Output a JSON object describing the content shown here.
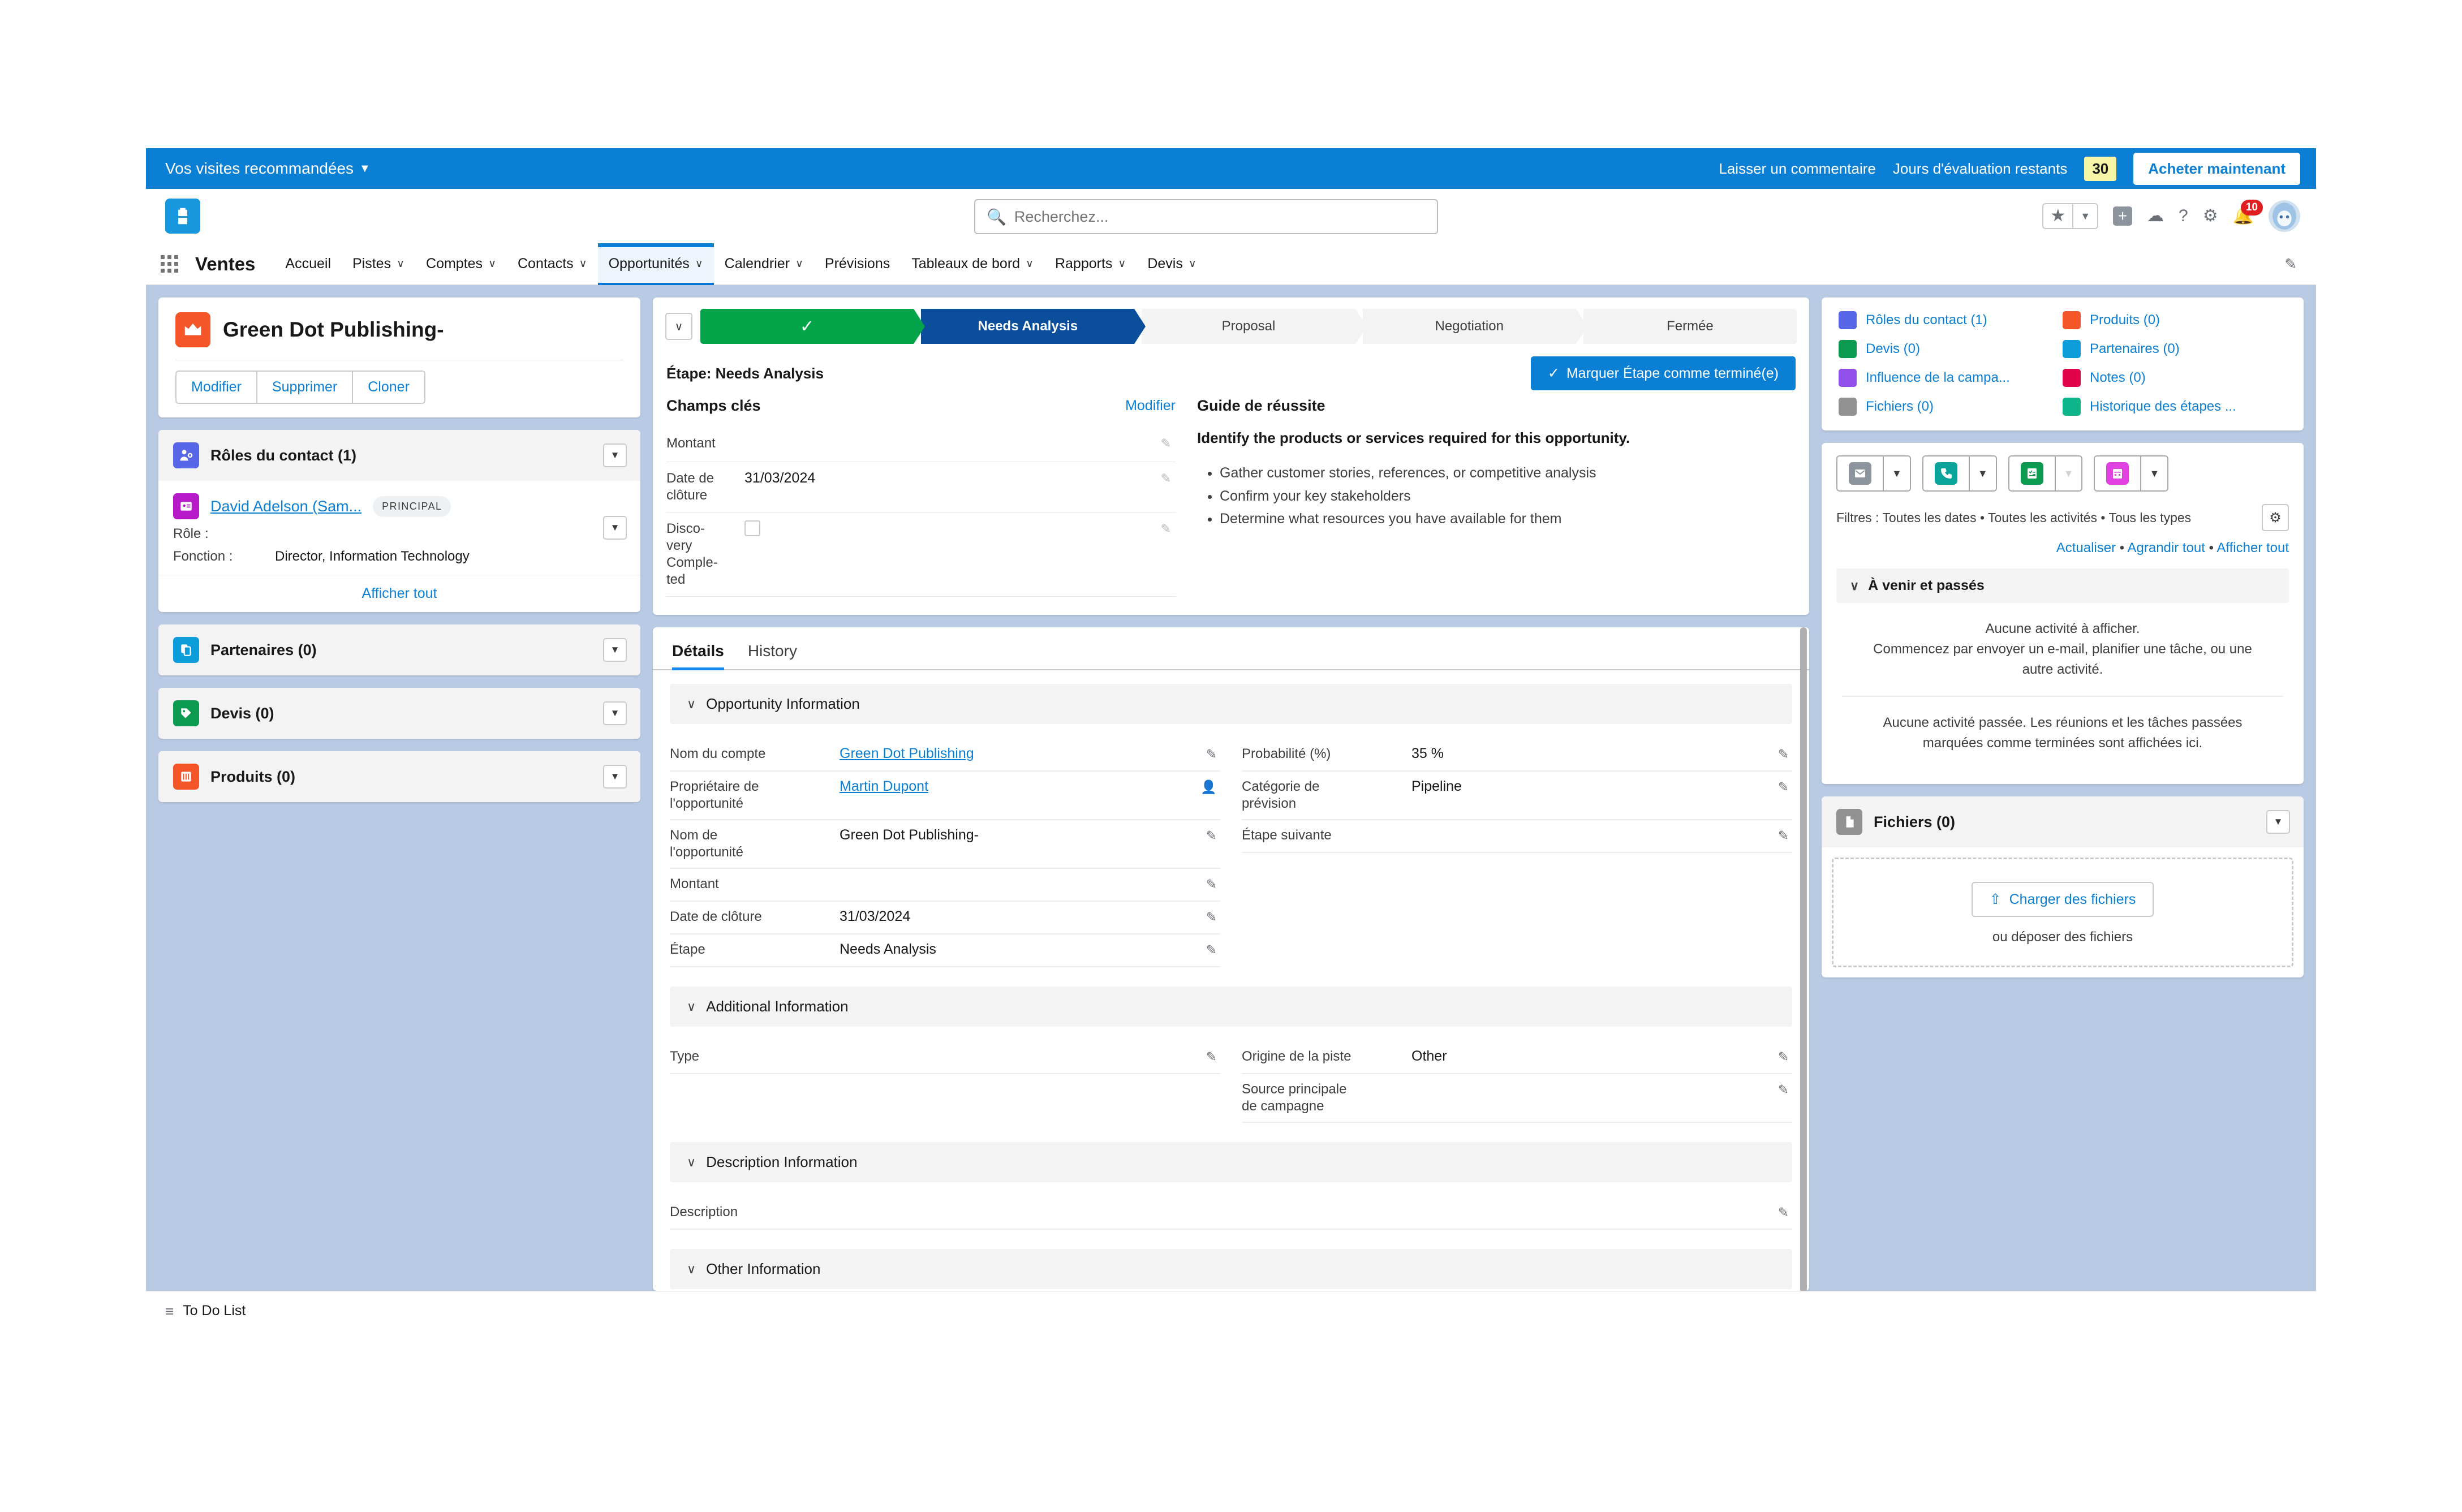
{
  "trial_bar": {
    "recommended_label": "Vos visites recommandées",
    "leave_comment": "Laisser un commentaire",
    "days_label": "Jours d'évaluation restants",
    "days_value": "30",
    "buy_now": "Acheter maintenant"
  },
  "header": {
    "search_placeholder": "Recherchez...",
    "notification_count": "10",
    "icons": [
      "favorites-star-icon",
      "favorites-chevron-icon",
      "add-icon",
      "cloud-icon",
      "help-icon",
      "setup-gear-icon",
      "notifications-bell-icon",
      "user-avatar"
    ]
  },
  "nav": {
    "app_name": "Ventes",
    "items": [
      {
        "label": "Accueil",
        "has_caret": false,
        "active": false
      },
      {
        "label": "Pistes",
        "has_caret": true,
        "active": false
      },
      {
        "label": "Comptes",
        "has_caret": true,
        "active": false
      },
      {
        "label": "Contacts",
        "has_caret": true,
        "active": false
      },
      {
        "label": "Opportunités",
        "has_caret": true,
        "active": true
      },
      {
        "label": "Calendrier",
        "has_caret": true,
        "active": false
      },
      {
        "label": "Prévisions",
        "has_caret": false,
        "active": false
      },
      {
        "label": "Tableaux de bord",
        "has_caret": true,
        "active": false
      },
      {
        "label": "Rapports",
        "has_caret": true,
        "active": false
      },
      {
        "label": "Devis",
        "has_caret": true,
        "active": false
      }
    ]
  },
  "highlight": {
    "title": "Green Dot Publishing-",
    "actions": [
      "Modifier",
      "Supprimer",
      "Cloner"
    ]
  },
  "sidebar": {
    "contact_roles": {
      "title": "Rôles du contact (1)",
      "color": "#5867e8",
      "contact_name": "David Adelson (Sam...",
      "badge": "PRINCIPAL",
      "role_label": "Rôle :",
      "role_value": "",
      "function_label": "Fonction :",
      "function_value": "Director, Information Technology",
      "view_all": "Afficher tout"
    },
    "cards": [
      {
        "title": "Partenaires (0)",
        "color": "#0d9dda",
        "icon": "partners-icon"
      },
      {
        "title": "Devis (0)",
        "color": "#0b9a4f",
        "icon": "quotes-icon"
      },
      {
        "title": "Produits (0)",
        "color": "#f4562a",
        "icon": "products-icon"
      }
    ]
  },
  "path": {
    "stages": [
      {
        "label": "",
        "state": "done",
        "check": "✓"
      },
      {
        "label": "Needs Analysis",
        "state": "current"
      },
      {
        "label": "Proposal",
        "state": "todo"
      },
      {
        "label": "Negotiation",
        "state": "todo"
      },
      {
        "label": "Fermée",
        "state": "todo"
      }
    ],
    "stage_label": "Étape: Needs Analysis",
    "mark_complete": "Marquer Étape comme terminé(e)",
    "key_fields_title": "Champs clés",
    "edit_link": "Modifier",
    "key_fields": [
      {
        "label": "Montant",
        "value": "",
        "type": "text"
      },
      {
        "label": "Date de clôture",
        "value": "31/03/2024",
        "type": "text"
      },
      {
        "label": "Disco-very Comple-ted",
        "value": "",
        "type": "checkbox"
      }
    ],
    "guide_title": "Guide de réussite",
    "guide_lead": "Identify the products or services required for this opportunity.",
    "guide_items": [
      "Gather customer stories, references, or competitive analysis",
      "Confirm your key stakeholders",
      "Determine what resources you have available for them"
    ]
  },
  "details": {
    "tabs": [
      {
        "label": "Détails",
        "active": true
      },
      {
        "label": "History",
        "active": false
      }
    ],
    "sections": [
      {
        "title": "Opportunity Information",
        "left_fields": [
          {
            "label": "Nom du compte",
            "value": "Green Dot Publishing",
            "link": true
          },
          {
            "label": "Propriétaire de l'opportunité",
            "value": "Martin Dupont",
            "link": true,
            "icon": "user-change-icon"
          },
          {
            "label": "Nom de l'opportunité",
            "value": "Green Dot Publishing-"
          },
          {
            "label": "Montant",
            "value": ""
          },
          {
            "label": "Date de clôture",
            "value": "31/03/2024"
          },
          {
            "label": "Étape",
            "value": "Needs Analysis"
          }
        ],
        "right_fields": [
          {
            "label": "Probabilité (%)",
            "value": "35 %"
          },
          {
            "label": "Catégorie de prévision",
            "value": "Pipeline"
          },
          {
            "label": "Étape suivante",
            "value": ""
          }
        ]
      },
      {
        "title": "Additional Information",
        "left_fields": [
          {
            "label": "Type",
            "value": ""
          }
        ],
        "right_fields": [
          {
            "label": "Origine de la piste",
            "value": "Other"
          },
          {
            "label": "Source principale de campagne",
            "value": ""
          }
        ]
      },
      {
        "title": "Description Information",
        "left_fields": [
          {
            "label": "Description",
            "value": ""
          }
        ],
        "right_fields": []
      },
      {
        "title": "Other Information",
        "left_fields": [],
        "right_fields": []
      }
    ]
  },
  "right_panel": {
    "quick_links_left": [
      {
        "label": "Rôles du contact (1)",
        "color": "#5867e8"
      },
      {
        "label": "Devis (0)",
        "color": "#0b9a4f"
      },
      {
        "label": "Influence de la campa...",
        "color": "#9050e9"
      },
      {
        "label": "Fichiers (0)",
        "color": "#919191"
      }
    ],
    "quick_links_right": [
      {
        "label": "Produits (0)",
        "color": "#f4562a"
      },
      {
        "label": "Partenaires (0)",
        "color": "#0d9dda"
      },
      {
        "label": "Notes (0)",
        "color": "#e1044b"
      },
      {
        "label": "Historique des étapes ...",
        "color": "#0fb58a"
      }
    ],
    "activity_buttons": [
      {
        "icon": "email-icon",
        "color": "#8c949e",
        "arrow_dim": false
      },
      {
        "icon": "call-icon",
        "color": "#0ba49a",
        "arrow_dim": false
      },
      {
        "icon": "task-icon",
        "color": "#0b9a4f",
        "arrow_dim": true
      },
      {
        "icon": "event-icon",
        "color": "#e241e2",
        "arrow_dim": false
      }
    ],
    "filters_text": "Filtres : Toutes les dates • Toutes les activités • Tous les types",
    "action_links": [
      "Actualiser",
      "Agrandir tout",
      "Afficher tout"
    ],
    "upcoming_title": "À venir et passés",
    "empty_upcoming_line1": "Aucune activité à afficher.",
    "empty_upcoming_line2": "Commencez par envoyer un e-mail, planifier une tâche, ou une autre activité.",
    "empty_past": "Aucune activité passée. Les réunions et les tâches passées marquées comme terminées sont affichées ici.",
    "files": {
      "title": "Fichiers (0)",
      "upload_label": "Charger des fichiers",
      "drop_label": "ou déposer des fichiers"
    }
  },
  "footer": {
    "todo_label": "To Do List"
  }
}
